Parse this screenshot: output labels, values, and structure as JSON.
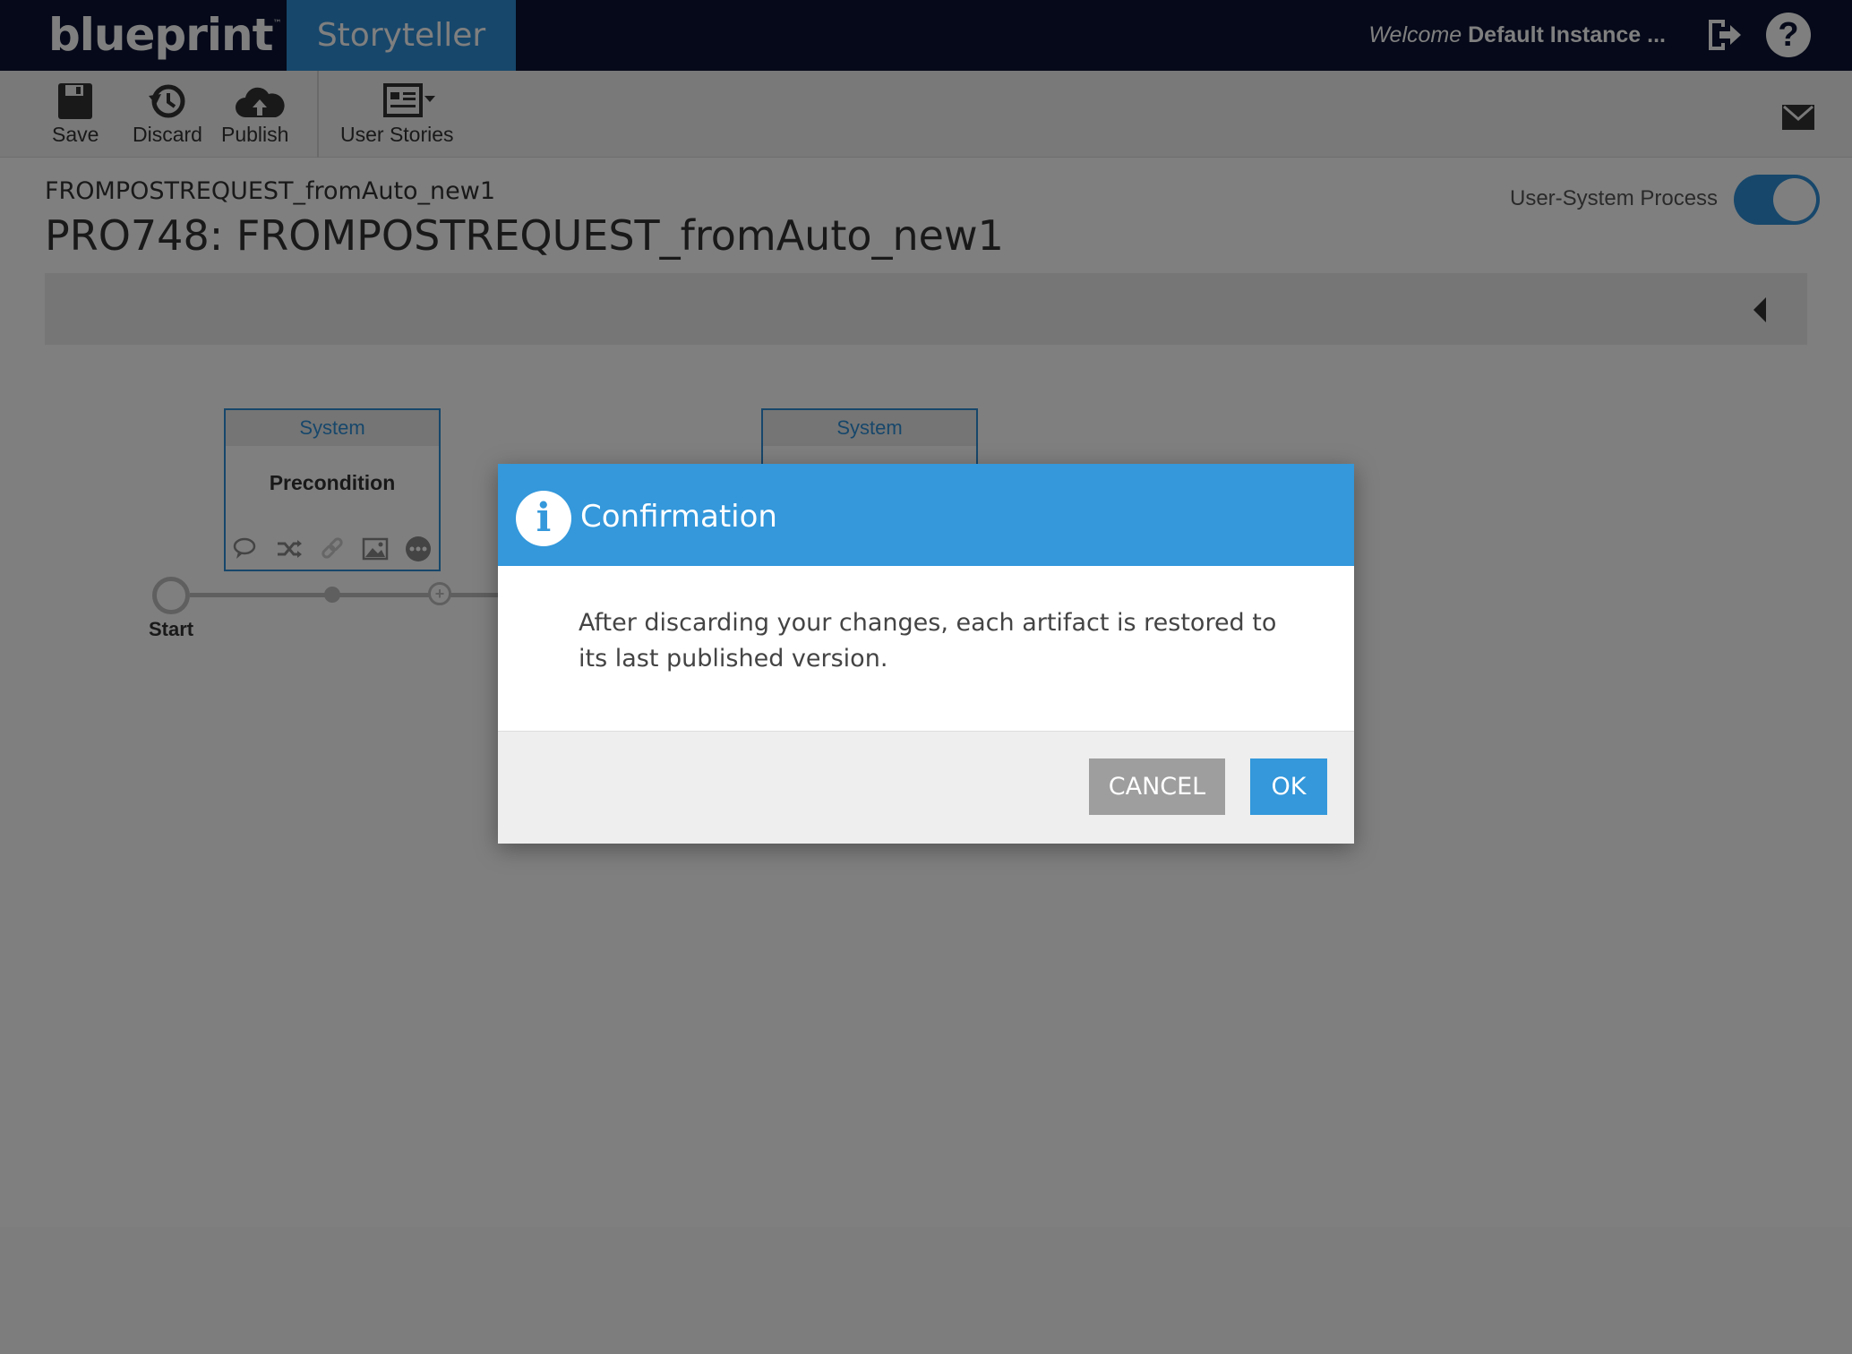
{
  "header": {
    "logo": "blueprint",
    "logo_mark": "™",
    "app_tab": "Storyteller",
    "welcome_word": "Welcome",
    "welcome_name": "Default Instance ...",
    "logout_icon": "logout-icon",
    "help_icon": "?"
  },
  "toolbar": {
    "save": "Save",
    "discard": "Discard",
    "publish": "Publish",
    "user_stories": "User Stories"
  },
  "artifact": {
    "breadcrumb": "FROMPOSTREQUEST_fromAuto_new1",
    "title": "PRO748: FROMPOSTREQUEST_fromAuto_new1"
  },
  "process_toggle": {
    "label": "User-System Process",
    "on": true
  },
  "diagram": {
    "start_label": "Start",
    "nodes": [
      {
        "header": "System",
        "title": "Precondition"
      },
      {
        "header": "System",
        "title": ""
      }
    ],
    "add_symbol": "+"
  },
  "dialog": {
    "title": "Confirmation",
    "info_glyph": "i",
    "message": "After discarding your changes, each artifact is restored to its last published version.",
    "cancel_label": "CANCEL",
    "ok_label": "OK"
  },
  "colors": {
    "topbar": "#0b1233",
    "accent": "#2f8fd6",
    "dialog_header": "#3498db",
    "cancel_button": "#9e9e9e"
  }
}
